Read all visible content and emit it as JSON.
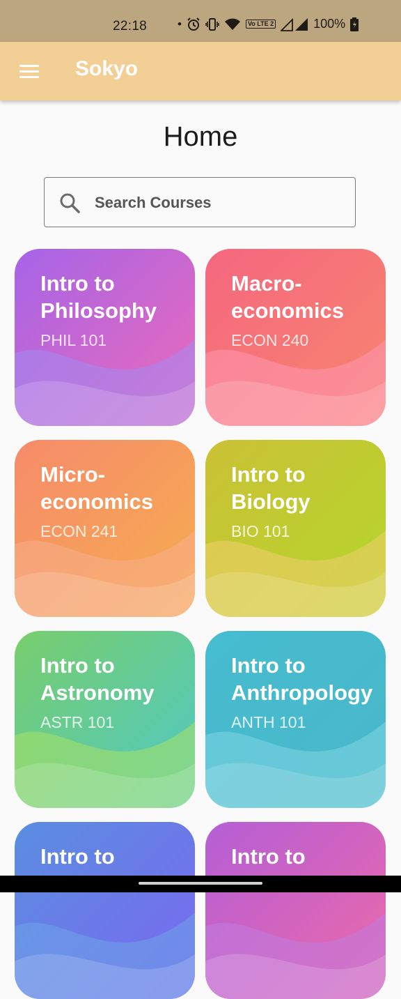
{
  "status_bar": {
    "time": "22:18",
    "dot": "•",
    "volte": "Vo LTE 2",
    "battery": "100%",
    "icons": [
      "alarm-icon",
      "vibrate-icon",
      "wifi-icon",
      "volte-icon",
      "signal-icon",
      "battery-icon"
    ]
  },
  "app_bar": {
    "title": "Sokyo",
    "menu_icon": "menu-icon"
  },
  "page": {
    "title": "Home"
  },
  "search": {
    "placeholder": "Search Courses",
    "value": ""
  },
  "courses": [
    {
      "title": "Intro to Philosophy",
      "code": "PHIL 101",
      "colors": [
        "#a564e8",
        "#ee6bb8",
        "#a28bf3"
      ]
    },
    {
      "title": "Macro-economics",
      "code": "ECON 240",
      "colors": [
        "#f6677f",
        "#f7866e",
        "#ff97b3"
      ]
    },
    {
      "title": "Micro-economics",
      "code": "ECON 241",
      "colors": [
        "#f68b6b",
        "#f6ad4f",
        "#f8ae8c"
      ]
    },
    {
      "title": "Intro to Biology",
      "code": "BIO 101",
      "colors": [
        "#cbc035",
        "#b3d72c",
        "#f3cd6d"
      ]
    },
    {
      "title": "Intro to Astronomy",
      "code": "ASTR 101",
      "colors": [
        "#78ce6c",
        "#4fc8c6",
        "#a9e165"
      ]
    },
    {
      "title": "Intro to Anthropology",
      "code": "ANTH 101",
      "colors": [
        "#45bcd0",
        "#4bb7c9",
        "#7fd6e2"
      ]
    },
    {
      "title": "Intro to",
      "code": "",
      "colors": [
        "#5a8ee0",
        "#7b67f0",
        "#6ea4e8"
      ]
    },
    {
      "title": "Intro to",
      "code": "",
      "colors": [
        "#b45ed6",
        "#ee6aa8",
        "#c07be0"
      ]
    }
  ]
}
